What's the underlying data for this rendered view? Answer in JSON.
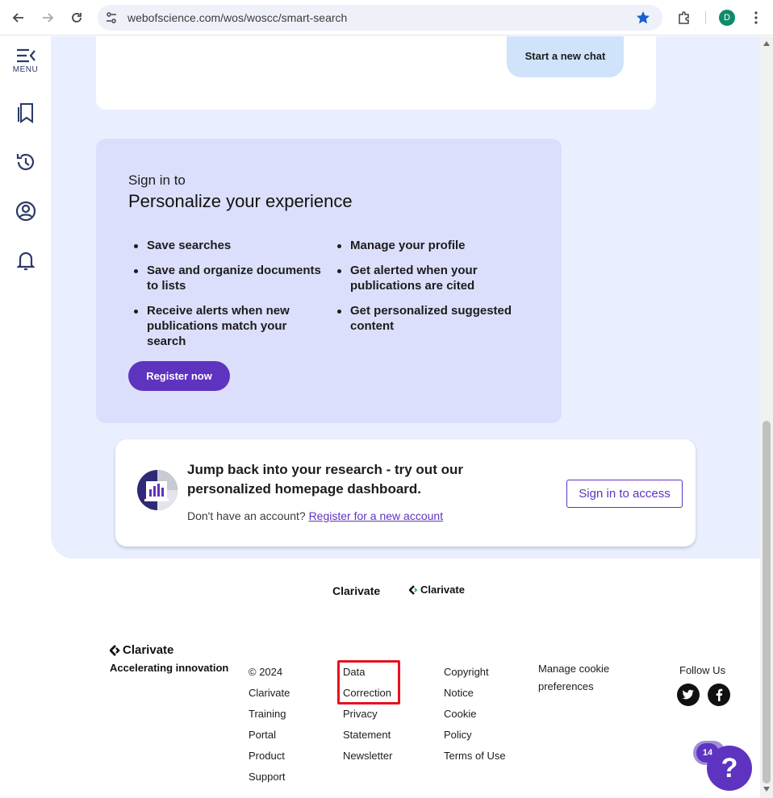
{
  "browser": {
    "url": "webofscience.com/wos/woscc/smart-search",
    "profile_initial": "D"
  },
  "sidebar": {
    "menu_label": "MENU"
  },
  "chat": {
    "start_new_chat": "Start a new chat"
  },
  "signin": {
    "pre_title": "Sign in to",
    "title": "Personalize your experience",
    "benefits_left": [
      "Save searches",
      "Save and organize documents to lists",
      "Receive alerts when new publications match your search"
    ],
    "benefits_right": [
      "Manage your profile",
      "Get alerted when your publications are cited",
      "Get personalized suggested content"
    ],
    "register_button": "Register now"
  },
  "dashboard": {
    "title": "Jump back into your research - try out our personalized homepage dashboard.",
    "no_account": "Don't have an account?",
    "register_link": "Register for a new account",
    "sign_in_button": "Sign in to access"
  },
  "footer": {
    "logo_text_1": "Clarivate",
    "logo_text_2": "Clarivate",
    "brand": "Clarivate",
    "tagline": "Accelerating innovation",
    "col1": [
      "© 2024",
      "Clarivate",
      "Training",
      "Portal",
      "Product",
      "Support"
    ],
    "col2": [
      "Data",
      "Correction",
      "Privacy",
      "Statement",
      "Newsletter"
    ],
    "col3": [
      "Copyright",
      "Notice",
      "Cookie",
      "Policy",
      "Terms of Use"
    ],
    "col4": [
      "Manage cookie",
      "preferences"
    ],
    "follow_us": "Follow Us"
  },
  "help": {
    "badge_count": "14",
    "symbol": "?"
  },
  "colors": {
    "accent": "#5e33bf",
    "panel_bg": "#e9efff",
    "signin_bg": "#dcdffb",
    "highlight_box": "#e8101f"
  }
}
